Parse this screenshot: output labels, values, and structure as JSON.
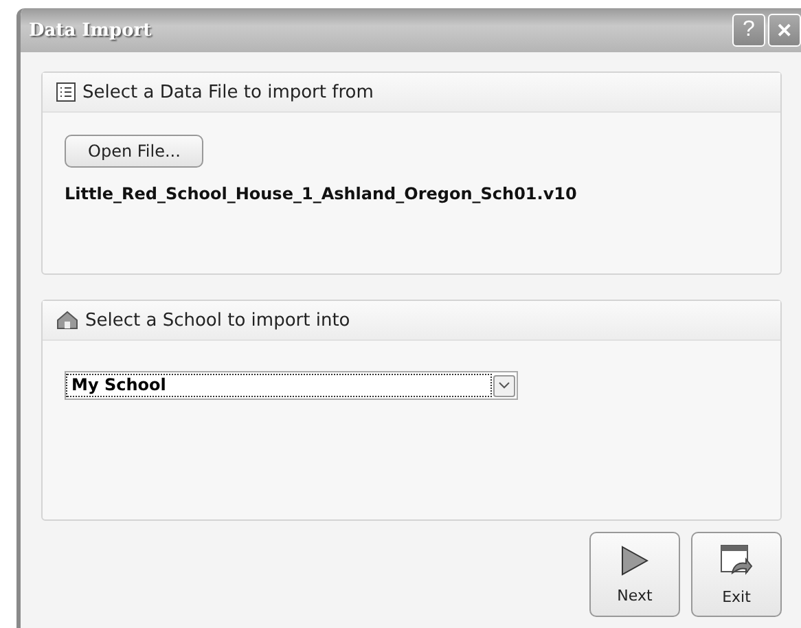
{
  "window": {
    "title": "Data Import"
  },
  "title_buttons": [
    {
      "kind": "help",
      "label": "?"
    },
    {
      "kind": "close",
      "label": "✕"
    }
  ],
  "file_section": {
    "heading": "Select a Data File to import from",
    "open_button": "Open File...",
    "file_name": "Little_Red_School_House_1_Ashland_Oregon_Sch01.v10"
  },
  "school_section": {
    "heading": "Select a School to import into",
    "school": "My School"
  },
  "buttons": [
    {
      "kind": "next",
      "label": "Next"
    },
    {
      "kind": "exit",
      "label": "Exit"
    }
  ]
}
